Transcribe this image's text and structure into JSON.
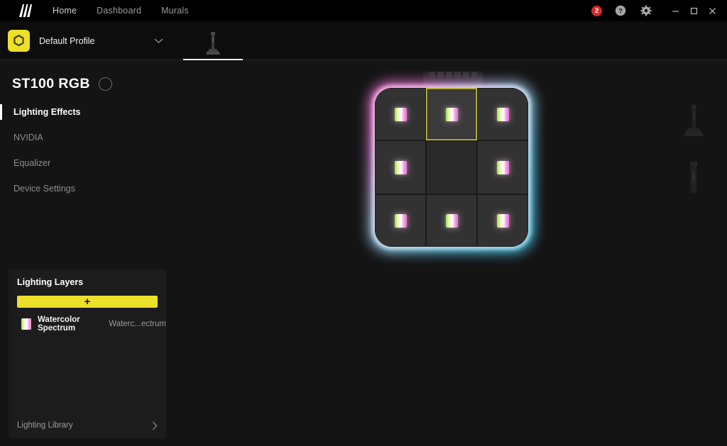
{
  "titlebar": {
    "logo_name": "corsair-sails-logo",
    "nav": [
      {
        "label": "Home",
        "active": true
      },
      {
        "label": "Dashboard",
        "active": false
      },
      {
        "label": "Murals",
        "active": false
      }
    ],
    "notification_count": "2",
    "help_icon": "help-circle-icon",
    "settings_icon": "gear-icon",
    "minimize_label": "—",
    "maximize_label": "□",
    "close_label": "✕"
  },
  "profilebar": {
    "profile_name": "Default Profile",
    "profile_tile_color": "#ece02a",
    "chevron_icon": "chevron-down-icon",
    "device_tab_icon": "headset-stand-icon"
  },
  "sidebar": {
    "device_title": "ST100 RGB",
    "power_toggle": "power-ring-button",
    "menu": [
      {
        "label": "Lighting Effects",
        "active": true
      },
      {
        "label": "NVIDIA",
        "active": false
      },
      {
        "label": "Equalizer",
        "active": false
      },
      {
        "label": "Device Settings",
        "active": false
      }
    ]
  },
  "layers_panel": {
    "title": "Lighting Layers",
    "add_button_label": "+",
    "add_button_color": "#ece02a",
    "layers": [
      {
        "name": "Watercolor Spectrum",
        "subtitle": "Waterc...ectrum",
        "swatch": "watercolor-gradient"
      }
    ],
    "footer_label": "Lighting Library",
    "footer_chevron": "chevron-right-icon"
  },
  "canvas": {
    "device_name": "ST100 RGB headset stand base",
    "selected_zone": "top-center",
    "glow_colors": {
      "left": "#f06fd0",
      "right": "#49c8f2"
    },
    "selection_color": "#c9c23f",
    "zones": [
      {
        "id": "top-left",
        "lit": true,
        "selected": false
      },
      {
        "id": "top-center",
        "lit": true,
        "selected": true
      },
      {
        "id": "top-right",
        "lit": true,
        "selected": false
      },
      {
        "id": "middle-left",
        "lit": true,
        "selected": false
      },
      {
        "id": "middle-center",
        "lit": false,
        "selected": false
      },
      {
        "id": "middle-right",
        "lit": true,
        "selected": false
      },
      {
        "id": "bottom-left",
        "lit": true,
        "selected": false
      },
      {
        "id": "bottom-center",
        "lit": true,
        "selected": false
      },
      {
        "id": "bottom-right",
        "lit": true,
        "selected": false
      }
    ],
    "thumbnails": [
      {
        "id": "stand-full-view"
      },
      {
        "id": "stand-post-view"
      }
    ]
  }
}
